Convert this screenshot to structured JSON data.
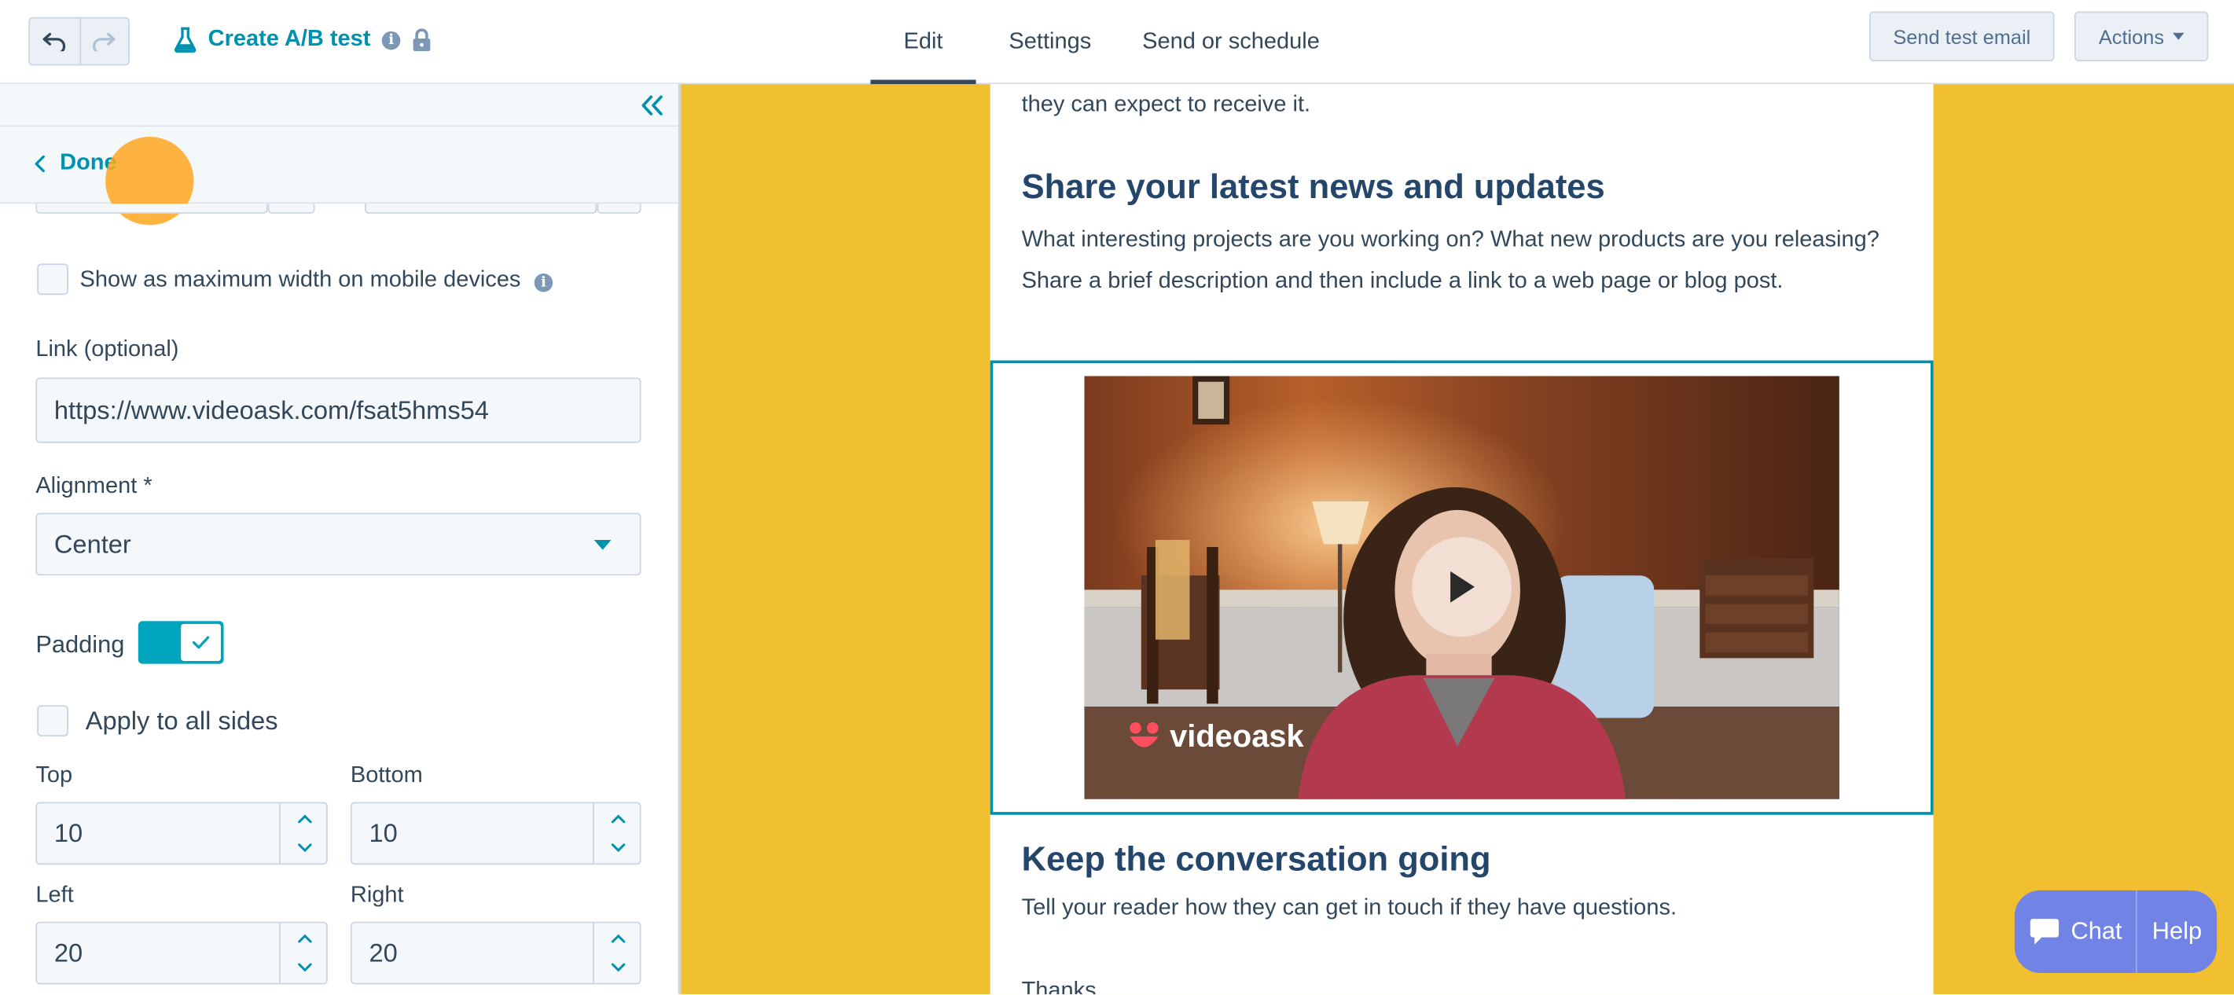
{
  "topbar": {
    "title": "Create A/B test",
    "tabs": [
      "Edit",
      "Settings",
      "Send or schedule"
    ],
    "active_tab": "Edit",
    "send_test_label": "Send test email",
    "actions_label": "Actions"
  },
  "panel": {
    "done_label": "Done",
    "mobile_checkbox_label": "Show as maximum width on mobile devices",
    "mobile_checked": false,
    "link_label": "Link (optional)",
    "link_value": "https://www.videoask.com/fsat5hms54",
    "alignment_label": "Alignment *",
    "alignment_value": "Center",
    "padding_label": "Padding",
    "padding_on": true,
    "apply_all_label": "Apply to all sides",
    "apply_all_checked": false,
    "top_label": "Top",
    "top_value": "10",
    "bottom_label": "Bottom",
    "bottom_value": "10",
    "left_label": "Left",
    "left_value": "20",
    "right_label": "Right",
    "right_value": "20"
  },
  "email": {
    "intro_line": "they can expect to receive it.",
    "heading1": "Share your latest news and updates",
    "paragraph1": "What interesting projects are you working on? What new products are you releasing? Share a brief description and then include a link to a web page or blog post.",
    "video_brand": "videoask",
    "heading2": "Keep the conversation going",
    "paragraph2": "Tell your reader how they can get in touch if they have questions.",
    "thanks": "Thanks"
  },
  "chat": {
    "chat_label": "Chat",
    "help_label": "Help"
  },
  "colors": {
    "accent": "#0091ae",
    "preview_bg": "#f0c030",
    "toggle": "#00a4bd",
    "chat_widget": "#7283e6"
  }
}
